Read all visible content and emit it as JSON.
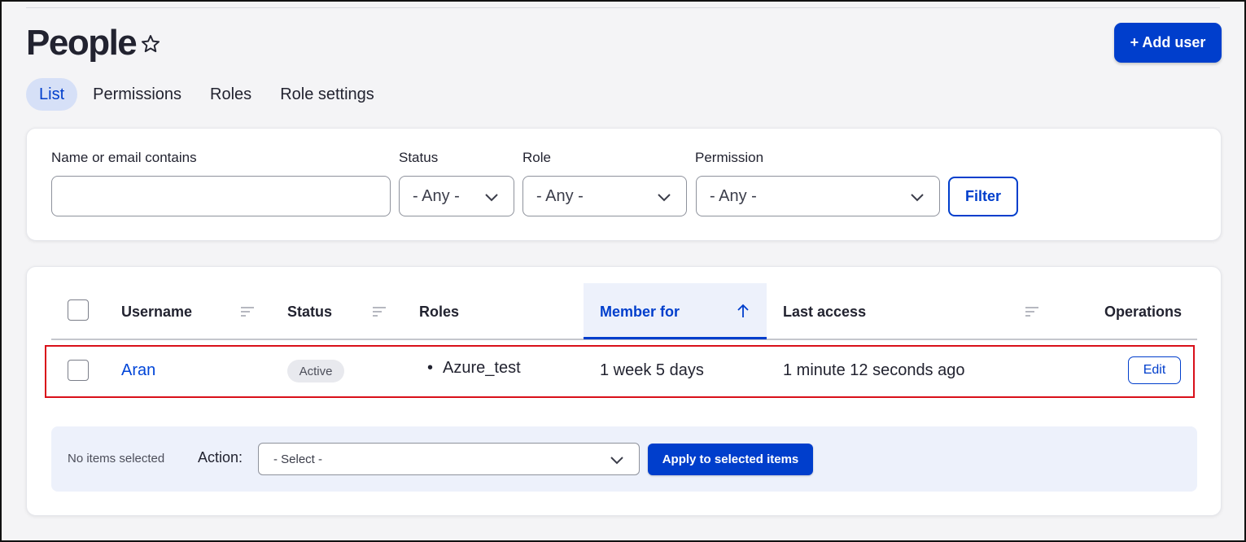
{
  "header": {
    "title": "People",
    "add_user_label": "+ Add user"
  },
  "tabs": [
    {
      "label": "List",
      "active": true
    },
    {
      "label": "Permissions",
      "active": false
    },
    {
      "label": "Roles",
      "active": false
    },
    {
      "label": "Role settings",
      "active": false
    }
  ],
  "filters": {
    "name_label": "Name or email contains",
    "name_value": "",
    "status_label": "Status",
    "status_value": "- Any -",
    "role_label": "Role",
    "role_value": "- Any -",
    "permission_label": "Permission",
    "permission_value": "- Any -",
    "filter_button": "Filter"
  },
  "table": {
    "columns": {
      "username": "Username",
      "status": "Status",
      "roles": "Roles",
      "member_for": "Member for",
      "last_access": "Last access",
      "operations": "Operations"
    },
    "rows": [
      {
        "username": "Aran",
        "status": "Active",
        "role": "Azure_test",
        "member_for": "1 week 5 days",
        "last_access": "1 minute 12 seconds ago",
        "operation": "Edit"
      }
    ]
  },
  "bulk": {
    "selected_text": "No items selected",
    "action_label": "Action:",
    "select_value": "- Select -",
    "apply_label": "Apply to selected items"
  },
  "colors": {
    "primary": "#003ecc",
    "highlight_border": "#d9101a"
  }
}
